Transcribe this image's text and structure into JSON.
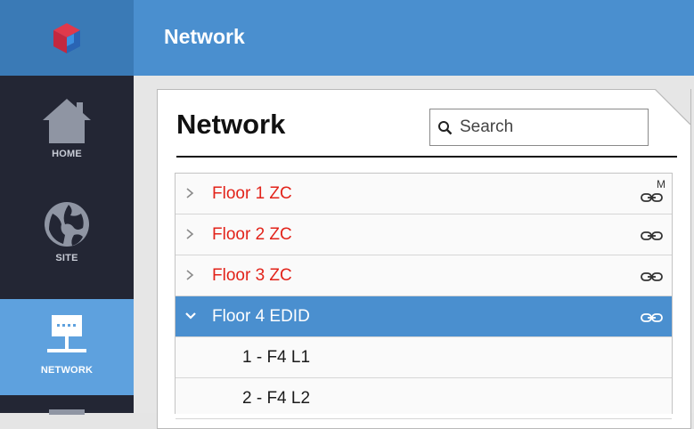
{
  "header": {
    "title": "Network",
    "logo_icon": "cube-logo-icon"
  },
  "nav": {
    "items": [
      {
        "label": "HOME",
        "icon": "home-icon",
        "active": false
      },
      {
        "label": "SITE",
        "icon": "globe-icon",
        "active": false
      },
      {
        "label": "NETWORK",
        "icon": "network-icon",
        "active": true
      }
    ]
  },
  "panel": {
    "title": "Network",
    "search": {
      "placeholder": "Search",
      "value": ""
    }
  },
  "tree": {
    "rows": [
      {
        "label": "Floor 1 ZC",
        "expanded": false,
        "status": "error",
        "link_badge": "M"
      },
      {
        "label": "Floor 2 ZC",
        "expanded": false,
        "status": "error"
      },
      {
        "label": "Floor 3 ZC",
        "expanded": false,
        "status": "error"
      },
      {
        "label": "Floor 4 EDID",
        "expanded": true,
        "selected": true,
        "children": [
          {
            "label": "1 - F4 L1"
          },
          {
            "label": "2 - F4 L2"
          }
        ]
      }
    ]
  },
  "colors": {
    "header_bg": "#4a8fcf",
    "logo_bg": "#3a7ab6",
    "nav_bg": "#232634",
    "nav_active_bg": "#5ea1de",
    "error_text": "#e2231a",
    "selected_bg": "#4a8fcf"
  }
}
